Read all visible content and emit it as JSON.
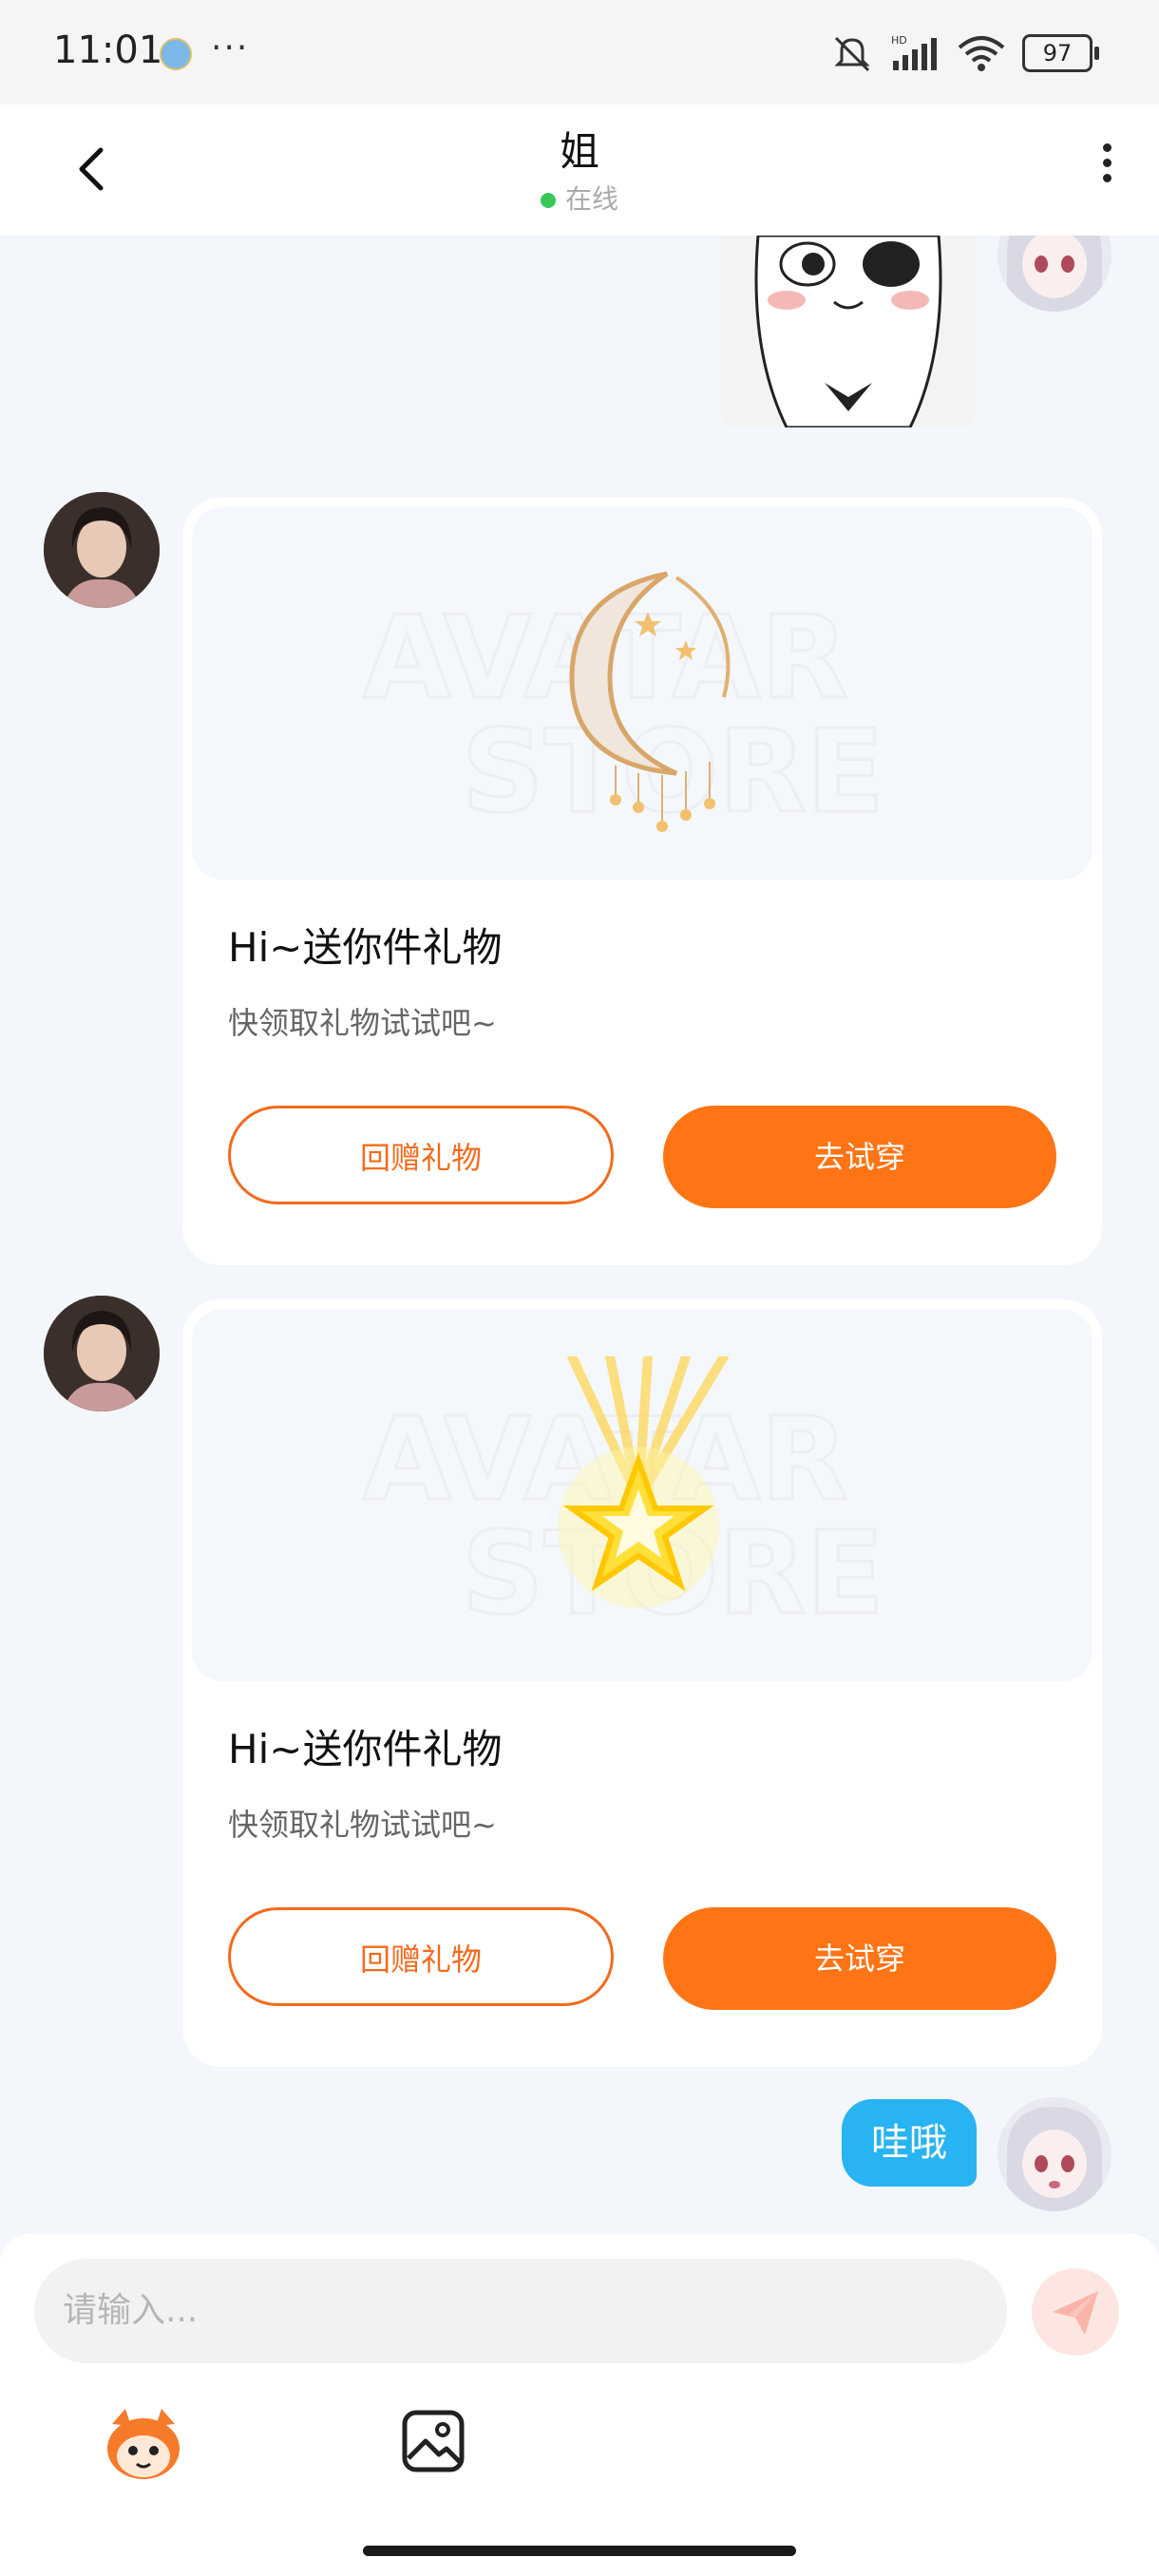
{
  "status_bar": {
    "time": "11:01",
    "dots": "···",
    "battery": "97"
  },
  "header": {
    "title": "姐",
    "status": "在线"
  },
  "messages": [
    {
      "type": "gift_card",
      "title": "Hi~送你件礼物",
      "subtitle": "快领取礼物试试吧~",
      "secondary_button": "回赠礼物",
      "primary_button": "去试穿",
      "watermark_line1": "AVATAR",
      "watermark_line2": "STORE",
      "gift": "crescent-moon-headpiece-icon"
    },
    {
      "type": "gift_card",
      "title": "Hi~送你件礼物",
      "subtitle": "快领取礼物试试吧~",
      "secondary_button": "回赠礼物",
      "primary_button": "去试穿",
      "watermark_line1": "AVATAR",
      "watermark_line2": "STORE",
      "gift": "glowing-star-icon"
    },
    {
      "type": "text",
      "text": "哇哦"
    }
  ],
  "input": {
    "placeholder": "请输入..."
  },
  "colors": {
    "accent": "#ff7414",
    "bubble": "#28b3f2",
    "online": "#38c75a",
    "background": "#f3f6fa"
  }
}
